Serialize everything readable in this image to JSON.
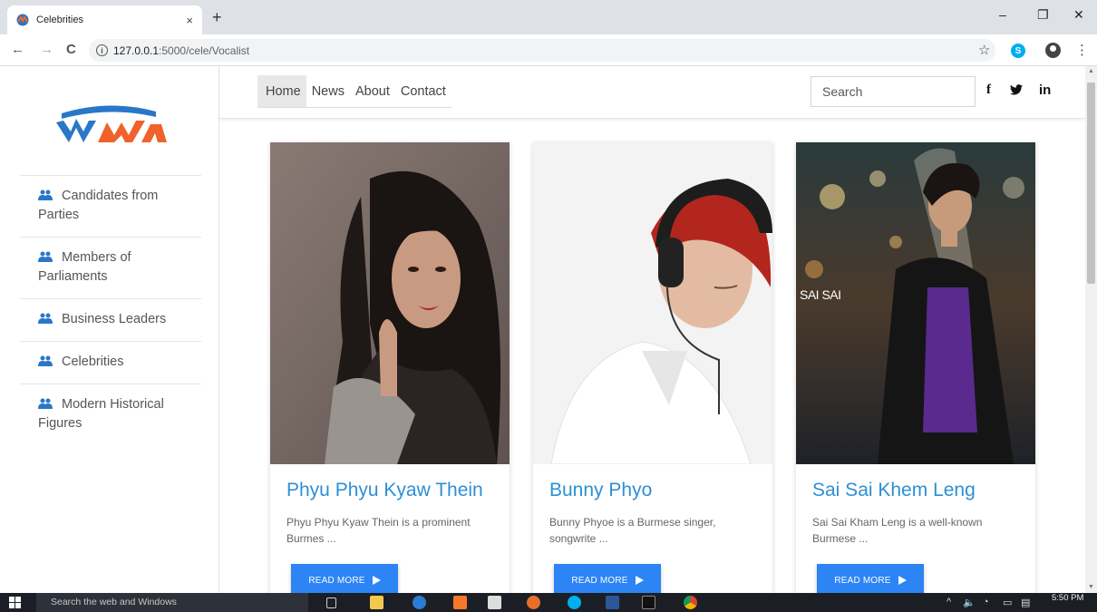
{
  "browser": {
    "tab_title": "Celebrities",
    "tab_close": "×",
    "new_tab": "+",
    "url_host": "127.0.0.1",
    "url_path": ":5000/cele/Vocalist",
    "minimize": "–",
    "restore": "❐",
    "close": "✕",
    "back": "←",
    "forward": "→",
    "reload": "C",
    "star": "☆",
    "menu": "⋮",
    "skype_letter": "S"
  },
  "sidebar": {
    "items": [
      {
        "label": "Candidates from Parties"
      },
      {
        "label": "Members of Parliaments"
      },
      {
        "label": "Business Leaders"
      },
      {
        "label": "Celebrities"
      },
      {
        "label": "Modern Historical Figures"
      }
    ]
  },
  "topnav": {
    "menu": [
      {
        "label": "Home"
      },
      {
        "label": "News"
      },
      {
        "label": "About"
      },
      {
        "label": "Contact"
      }
    ],
    "search_placeholder": "Search",
    "social": {
      "facebook": "f",
      "twitter": "🐦",
      "linkedin": "in"
    }
  },
  "cards": [
    {
      "name": "Phyu Phyu Kyaw Thein",
      "desc": "Phyu Phyu Kyaw Thein is a prominent Burmes ...",
      "button": "READ MORE"
    },
    {
      "name": "Bunny Phyo",
      "desc": "Bunny Phyoe is a Burmese singer, songwrite ...",
      "button": "READ MORE"
    },
    {
      "name": "Sai Sai Khem Leng",
      "desc": "Sai Sai Kham Leng is a well-known Burmese ...",
      "button": "READ MORE"
    }
  ],
  "card3_overlay": "SAI SAI",
  "taskbar": {
    "search_text": "Search the web and Windows",
    "clock_time": "5:50 PM",
    "tray_chevron": "^"
  },
  "colors": {
    "accent": "#2c8fd6",
    "button": "#2c84f5",
    "sidebar_icon": "#2a77c9"
  }
}
